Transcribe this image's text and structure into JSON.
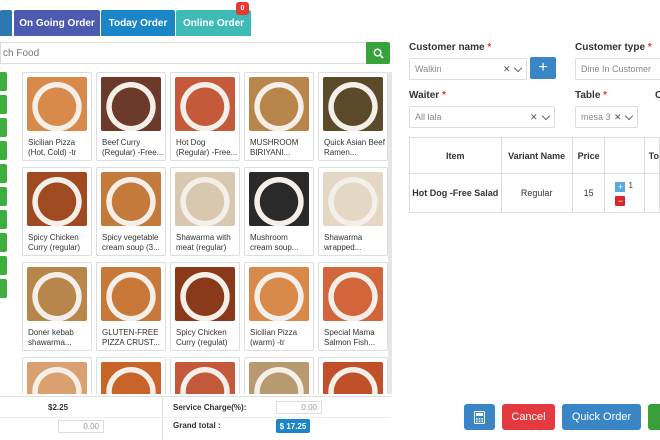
{
  "tabs": {
    "ongoing": "On Going Order",
    "today": "Today Order",
    "online": "Online Order",
    "online_badge": "0"
  },
  "search": {
    "placeholder": "ch Food"
  },
  "products": [
    {
      "name": "Sicilian Pizza (Hot, Cold) -tr",
      "color": "#d88a4a"
    },
    {
      "name": "Beef Curry (Regular) -Free...",
      "color": "#6b3a2a"
    },
    {
      "name": "Hot Dog (Regular) -Free...",
      "color": "#c45a3a"
    },
    {
      "name": "MUSHROOM BIRIYANI...",
      "color": "#b8864a"
    },
    {
      "name": "Quick Asian Beef Ramen...",
      "color": "#5a4a2a"
    },
    {
      "name": "Spicy Chicken Curry (regular)",
      "color": "#a04a22"
    },
    {
      "name": "Spicy vegetable cream soup (3...",
      "color": "#c47a3a"
    },
    {
      "name": "Shawarma with meat (regular)",
      "color": "#d9c8b0"
    },
    {
      "name": "Mushroom cream soup...",
      "color": "#2a2a2a"
    },
    {
      "name": "Shawarma wrapped...",
      "color": "#e4d8c4"
    },
    {
      "name": "Doner kebab shawarma...",
      "color": "#b8864a"
    },
    {
      "name": "GLUTEN-FREE PIZZA CRUST...",
      "color": "#c87838"
    },
    {
      "name": "Spicy Chicken Curry (regulat)",
      "color": "#8a3a1a"
    },
    {
      "name": "Sicilian Pizza (warm) -tr",
      "color": "#d88a4a"
    },
    {
      "name": "Special Mama Salmon Fish...",
      "color": "#d2653a"
    },
    {
      "name": "",
      "color": "#d9a070"
    },
    {
      "name": "",
      "color": "#c8642a"
    },
    {
      "name": "",
      "color": "#c4583a"
    },
    {
      "name": "",
      "color": "#b89a70"
    },
    {
      "name": "",
      "color": "#c0502a"
    }
  ],
  "totals": {
    "left_amount": "$2.25",
    "left_input": "0.00",
    "service_label": "Service Charge(%):",
    "service_value": "0.00",
    "grand_label": "Grand total :",
    "grand_value": "$ 17.25"
  },
  "form": {
    "customer_name_label": "Customer name",
    "customer_name_value": "Walkin",
    "customer_type_label": "Customer type",
    "customer_type_value": "Dine In Customer",
    "waiter_label": "Waiter",
    "waiter_value": "All lala",
    "table_label": "Table",
    "table_value": "mesa 3",
    "extra_label": "C",
    "required_mark": "*"
  },
  "order_table": {
    "headers": [
      "Item",
      "Variant Name",
      "Price",
      "",
      "To"
    ],
    "rows": [
      {
        "item": "Hot Dog -Free Salad",
        "variant": "Regular",
        "price": "15",
        "qty": "1"
      }
    ]
  },
  "actions": {
    "cancel": "Cancel",
    "quick_order": "Quick Order"
  },
  "colors": {
    "tab_ongoing": "#4c5bb0",
    "tab_today": "#1a86c7",
    "tab_online": "#3fbbb6",
    "primary": "#3a85c6",
    "danger": "#e53940",
    "success": "#37a33a"
  }
}
